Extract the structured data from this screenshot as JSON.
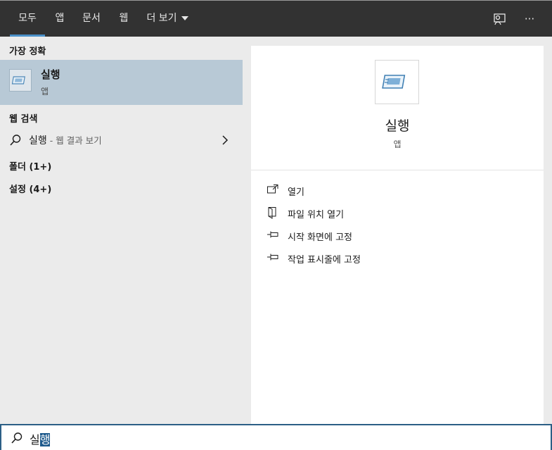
{
  "tabs": [
    {
      "label": "모두",
      "active": true
    },
    {
      "label": "앱",
      "active": false
    },
    {
      "label": "문서",
      "active": false
    },
    {
      "label": "웹",
      "active": false
    },
    {
      "label": "더 보기",
      "active": false
    }
  ],
  "top_icons": [
    "feedback-icon",
    "more-options-icon"
  ],
  "more_glyph": "···",
  "left": {
    "best_match_header": "가장 정확",
    "best_match": {
      "title": "실행",
      "type": "앱",
      "icon": "run-dialog-icon"
    },
    "web_search_header": "웹 검색",
    "web_search": {
      "query": "실행",
      "suffix": " - 웹 결과 보기"
    },
    "folders_header": "폴더 (1+)",
    "settings_header": "설정 (4+)"
  },
  "right": {
    "title": "실행",
    "type": "앱",
    "actions": [
      {
        "label": "열기",
        "icon": "open-icon"
      },
      {
        "label": "파일 위치 열기",
        "icon": "file-location-icon"
      },
      {
        "label": "시작 화면에 고정",
        "icon": "pin-icon"
      },
      {
        "label": "작업 표시줄에 고정",
        "icon": "pin-icon"
      }
    ]
  },
  "search": {
    "typed": "실",
    "selected": "행"
  },
  "colors": {
    "topbar": "#323232",
    "accent": "#4a90c8",
    "selection": "#b8c9d6",
    "search_border": "#2c5f86"
  }
}
